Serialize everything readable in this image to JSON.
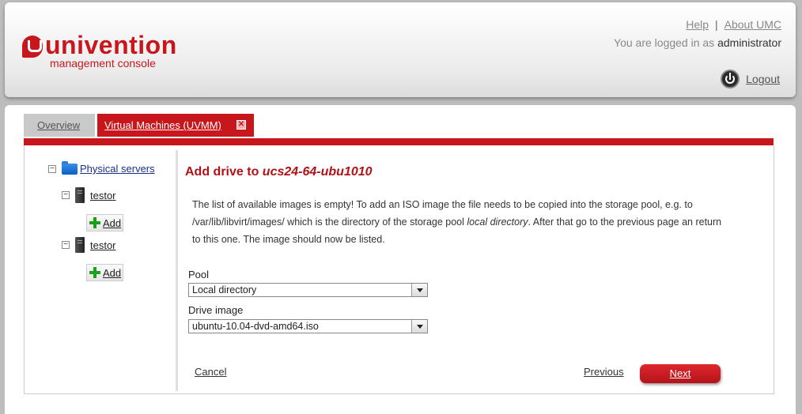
{
  "header": {
    "logo_word": "univention",
    "logo_sub": "management console",
    "help_label": "Help",
    "about_label": "About UMC",
    "logged_in_prefix": "You are logged in as",
    "username": "administrator",
    "logout_label": "Logout"
  },
  "tabs": [
    {
      "label": "Overview"
    },
    {
      "label": "Virtual Machines (UVMM)",
      "close": "✕"
    }
  ],
  "tree": {
    "root_label": "Physical servers",
    "servers": [
      {
        "label": "testor",
        "add_label": "Add"
      },
      {
        "label": "testor",
        "add_label": "Add"
      }
    ],
    "collapse_glyph": "−"
  },
  "wizard": {
    "title_prefix": "Add drive to",
    "title_vm": "ucs24-64-ubu1010",
    "info_part1": "The list of available images is empty! To add an ISO image the file needs to be copied into the storage pool, e.g. to /var/lib/libvirt/images/ which is the directory of the storage pool",
    "info_pool": "local directory",
    "info_part2": ". After that go to the previous page an return to this one. The image should now be listed.",
    "pool_label": "Pool",
    "pool_value": "Local directory",
    "drive_label": "Drive image",
    "drive_value": "ubuntu-10.04-dvd-amd64.iso",
    "cancel_label": "Cancel",
    "previous_label": "Previous",
    "next_label": "Next"
  },
  "colors": {
    "brand_red": "#c8161d"
  }
}
